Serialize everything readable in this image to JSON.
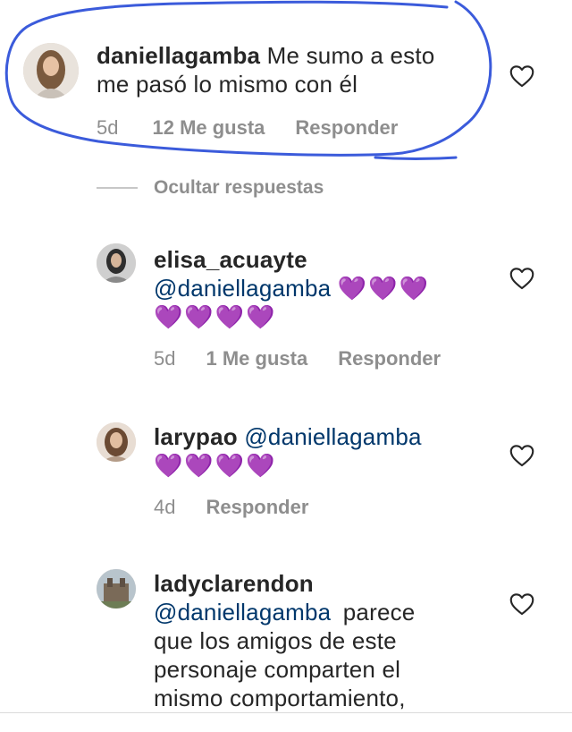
{
  "comments": [
    {
      "username": "daniellagamba",
      "body_line1": "Me sumo a esto",
      "body_line2": "me pasó lo mismo con él",
      "time": "5d",
      "likes": "12 Me gusta",
      "reply": "Responder"
    },
    {
      "username": "elisa_acuayte",
      "mention": "@daniellagamba",
      "hearts_line1": "💜💜💜",
      "hearts_line2": "💜💜💜💜",
      "time": "5d",
      "likes": "1 Me gusta",
      "reply": "Responder"
    },
    {
      "username": "larypao",
      "mention": "@daniellagamba",
      "hearts_line1": "💜💜💜💜",
      "time": "4d",
      "reply": "Responder"
    },
    {
      "username": "ladyclarendon",
      "mention": "@daniellagamba",
      "body_line1": "parece",
      "body_line2": "que los amigos de este",
      "body_line3": "personaje comparten el",
      "body_line4": "mismo comportamiento,"
    }
  ],
  "hide_replies": "Ocultar respuestas",
  "icons": {
    "like": "heart-outline-icon"
  },
  "colors": {
    "annotation": "#3b5bdb",
    "mention": "#00376b",
    "meta": "#8e8e8e"
  }
}
